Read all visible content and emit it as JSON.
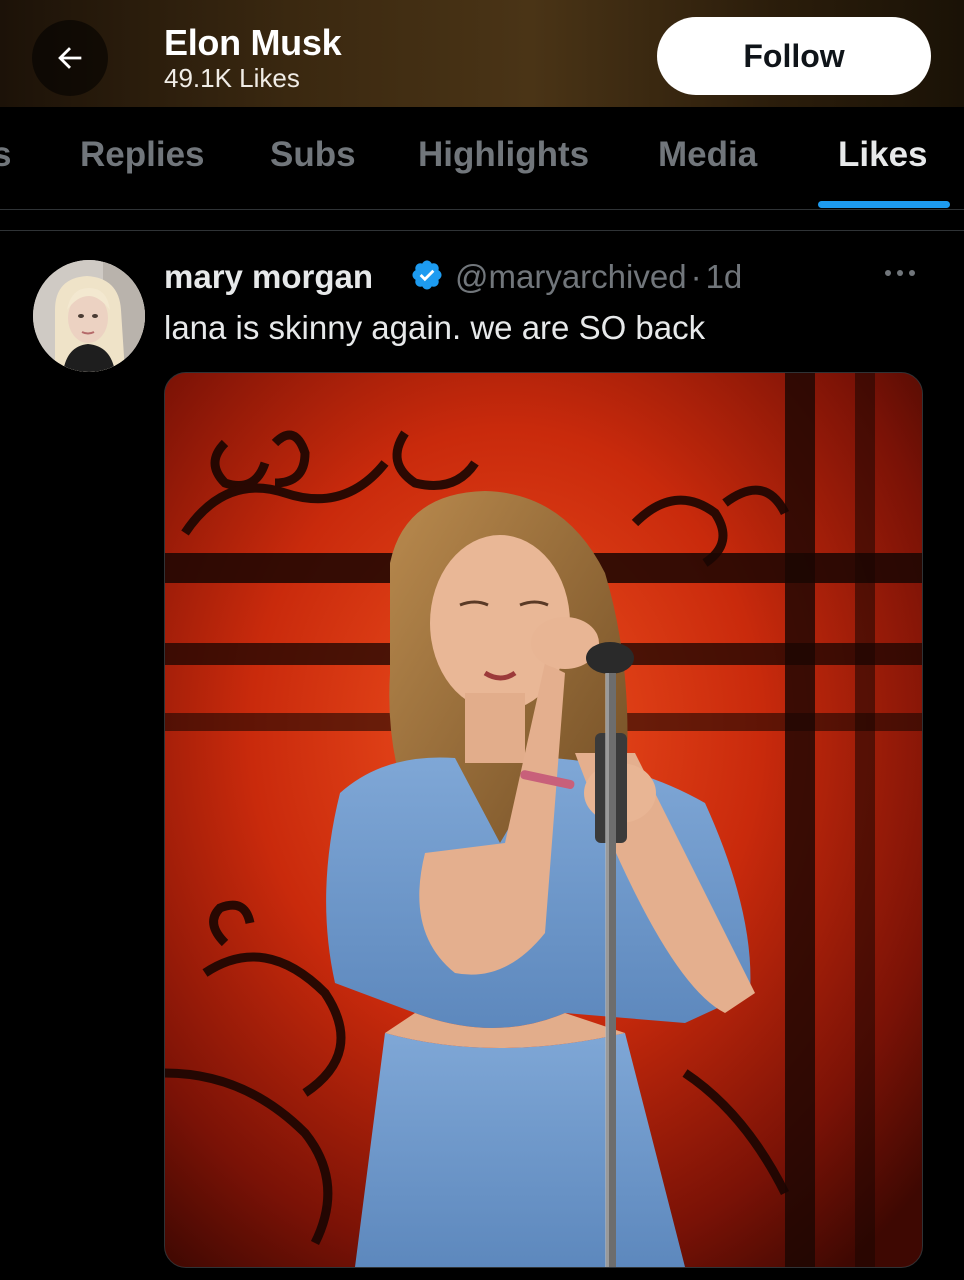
{
  "header": {
    "title": "Elon Musk",
    "subtitle": "49.1K Likes",
    "follow_label": "Follow"
  },
  "tabs": [
    {
      "label": "s"
    },
    {
      "label": "Replies"
    },
    {
      "label": "Subs"
    },
    {
      "label": "Highlights"
    },
    {
      "label": "Media"
    },
    {
      "label": "Likes",
      "active": true
    }
  ],
  "post": {
    "author_name": "mary morgan",
    "handle": "@maryarchived",
    "separator": "·",
    "time": "1d",
    "text": "lana is skinny again. we are SO back",
    "verified": true
  },
  "colors": {
    "accent": "#1d9bf0",
    "background": "#000000",
    "muted_text": "#71767b"
  },
  "icons": {
    "back": "arrow-left-icon",
    "verified": "verified-badge-icon",
    "more": "more-horizontal-icon"
  }
}
